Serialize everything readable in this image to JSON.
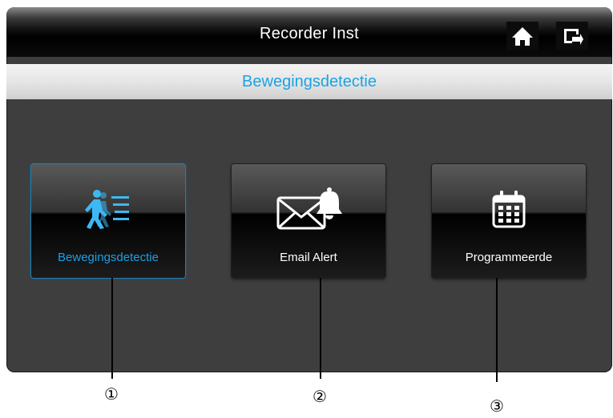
{
  "header": {
    "title": "Recorder Inst"
  },
  "subheader": {
    "title": "Bewegingsdetectie"
  },
  "toolbar": {
    "home_icon": "home-icon",
    "back_icon": "return-icon"
  },
  "menu": {
    "items": [
      {
        "label": "Bewegingsdetectie",
        "icon": "motion-detection-icon",
        "selected": true
      },
      {
        "label": "Email Alert",
        "icon": "email-alert-icon",
        "selected": false
      },
      {
        "label": "Programmeerde",
        "icon": "calendar-icon",
        "selected": false
      }
    ]
  },
  "callouts": {
    "items": [
      "①",
      "②",
      "③"
    ]
  },
  "colors": {
    "accent": "#1aa3e4",
    "panel": "#3e3e3e",
    "titlebar": "#000000"
  }
}
